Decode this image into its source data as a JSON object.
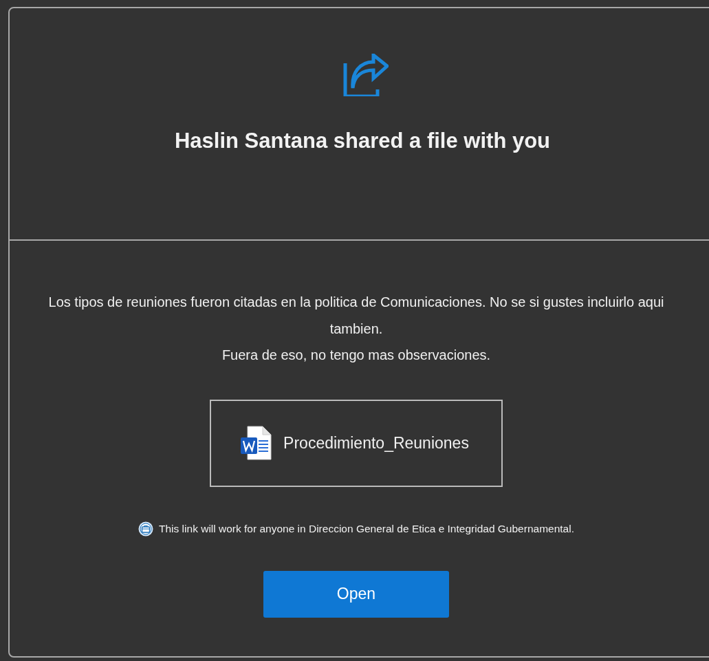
{
  "header": {
    "title": "Haslin Santana shared a file with you"
  },
  "message": [
    "Los tipos de reuniones fueron citadas en la politica de Comunicaciones. No se si gustes incluirlo aqui tambien.",
    "Fuera de eso, no tengo mas observaciones."
  ],
  "file": {
    "name": "Procedimiento_Reuniones"
  },
  "link_note": "This link will work for anyone in Direccion General de Etica e Integridad Gubernamental.",
  "open_button": "Open"
}
